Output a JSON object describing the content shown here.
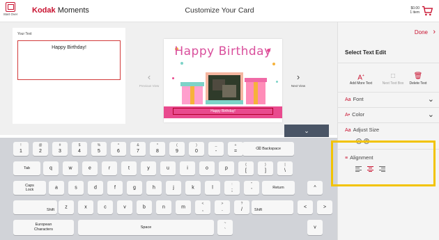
{
  "header": {
    "start_over": "Start Over",
    "brand_kodak": "Kodak",
    "brand_moments": "Moments",
    "title": "Customize Your Card",
    "cart_price": "$0.00",
    "cart_items": "1 item"
  },
  "editor": {
    "your_text_label": "Your Text",
    "your_text_value": "Happy Birthday!",
    "previous_view": "Previous View",
    "next_view": "Next View",
    "card_title": "Happy Birthday",
    "card_text": "Happy Birthday!",
    "collapse_icon": "chevron-down"
  },
  "keyboard": {
    "row1": [
      {
        "top": "!",
        "main": "1"
      },
      {
        "top": "@",
        "main": "2"
      },
      {
        "top": "#",
        "main": "3"
      },
      {
        "top": "$",
        "main": "4"
      },
      {
        "top": "%",
        "main": "5"
      },
      {
        "top": "^",
        "main": "6"
      },
      {
        "top": "&",
        "main": "7"
      },
      {
        "top": "*",
        "main": "8"
      },
      {
        "top": "(",
        "main": "9"
      },
      {
        "top": ")",
        "main": "0"
      },
      {
        "top": "_",
        "main": "-"
      },
      {
        "top": "+",
        "main": "="
      }
    ],
    "backspace": "Backspace",
    "tab": "Tab",
    "row2": [
      {
        "top": "",
        "main": "q"
      },
      {
        "top": "",
        "main": "w"
      },
      {
        "top": "",
        "main": "e"
      },
      {
        "top": "",
        "main": "r"
      },
      {
        "top": "",
        "main": "t"
      },
      {
        "top": "",
        "main": "y"
      },
      {
        "top": "",
        "main": "u"
      },
      {
        "top": "",
        "main": "i"
      },
      {
        "top": "",
        "main": "o"
      },
      {
        "top": "",
        "main": "p"
      },
      {
        "top": "{",
        "main": "["
      },
      {
        "top": "}",
        "main": "]"
      },
      {
        "top": "|",
        "main": "\\"
      }
    ],
    "caps_lock": "Caps Lock",
    "row3": [
      {
        "top": "",
        "main": "a"
      },
      {
        "top": "",
        "main": "s"
      },
      {
        "top": "",
        "main": "d"
      },
      {
        "top": "",
        "main": "f"
      },
      {
        "top": "",
        "main": "g"
      },
      {
        "top": "",
        "main": "h"
      },
      {
        "top": "",
        "main": "j"
      },
      {
        "top": "",
        "main": "k"
      },
      {
        "top": "",
        "main": "l"
      },
      {
        "top": ":",
        "main": ";"
      },
      {
        "top": "\"",
        "main": "'"
      }
    ],
    "return": "Return",
    "shift_left": "Shift",
    "row4": [
      {
        "top": "",
        "main": "z"
      },
      {
        "top": "",
        "main": "x"
      },
      {
        "top": "",
        "main": "c"
      },
      {
        "top": "",
        "main": "v"
      },
      {
        "top": "",
        "main": "b"
      },
      {
        "top": "",
        "main": "n"
      },
      {
        "top": "",
        "main": "m"
      },
      {
        "top": "<",
        "main": ","
      },
      {
        "top": ">",
        "main": "."
      },
      {
        "top": "?",
        "main": "/"
      }
    ],
    "shift_right": "Shift",
    "european": "European Characters",
    "space": "Space",
    "arrow_up": "^",
    "arrow_down": "v",
    "arrow_left": "<",
    "arrow_right": ">",
    "dot_key_top": "~",
    "dot_key_main": "`"
  },
  "panel": {
    "done": "Done",
    "title": "Select Text Edit",
    "add_more_text": "Add More Text",
    "next_text_box": "Next Text Box",
    "delete_text": "Delete Text",
    "font": "Font",
    "color": "Color",
    "adjust_size": "Adjust Size",
    "alignment": "Alignment",
    "selected_alignment": "center"
  },
  "colors": {
    "accent": "#c8102e",
    "highlight": "#f2c300",
    "card_band": "#e94a8e",
    "card_title": "#d94f9c"
  }
}
